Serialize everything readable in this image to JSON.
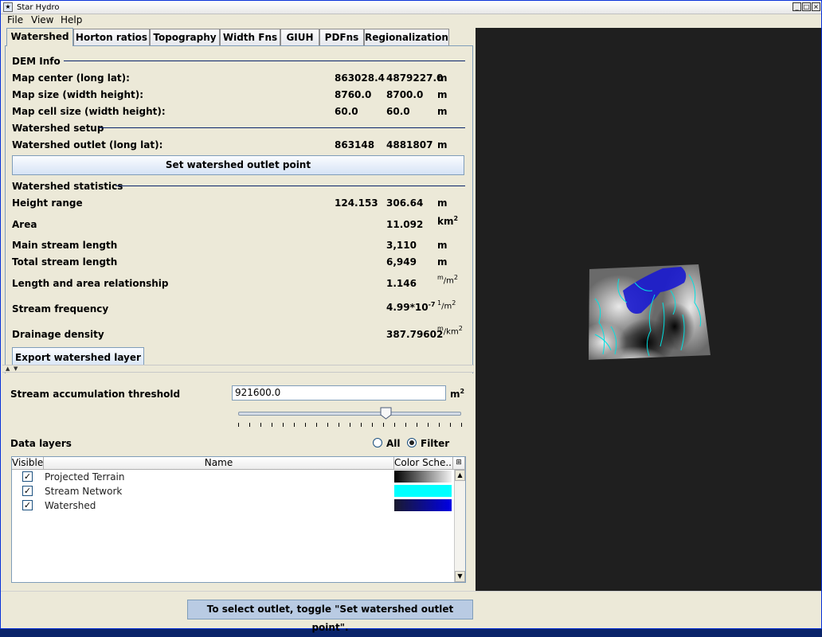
{
  "window": {
    "title": "Star Hydro"
  },
  "menu": [
    "File",
    "View",
    "Help"
  ],
  "tabs": [
    "Watershed",
    "Horton ratios",
    "Topography",
    "Width Fns",
    "GIUH",
    "PDFns",
    "Regionalization"
  ],
  "dem_info": {
    "heading": "DEM Info",
    "rows": [
      {
        "label": "Map center (long lat):",
        "v1": "863028.4",
        "v2": "4879227.0",
        "unit": "m"
      },
      {
        "label": "Map size (width height):",
        "v1": "8760.0",
        "v2": "8700.0",
        "unit": "m"
      },
      {
        "label": "Map cell size (width height):",
        "v1": "60.0",
        "v2": "60.0",
        "unit": "m"
      }
    ]
  },
  "setup": {
    "heading": "Watershed setup",
    "outlet": {
      "label": "Watershed outlet (long lat):",
      "v1": "863148",
      "v2": "4881807",
      "unit": "m"
    },
    "button": "Set watershed outlet point"
  },
  "stats": {
    "heading": "Watershed statistics",
    "height_range": {
      "label": "Height range",
      "v1": "124.153",
      "v2": "306.64",
      "unit": "m"
    },
    "area": {
      "label": "Area",
      "value": "11.092",
      "unit": "km",
      "unit_sup": "2"
    },
    "main_stream": {
      "label": "Main stream length",
      "value": "3,110",
      "unit": "m"
    },
    "total_stream": {
      "label": "Total stream length",
      "value": "6,949",
      "unit": "m"
    },
    "length_area": {
      "label": "Length and area relationship",
      "value": "1.146",
      "unit_num": "m",
      "unit_den": "m",
      "unit_sup": "2"
    },
    "stream_freq": {
      "label": "Stream frequency",
      "value": "4.99*10",
      "value_sup": "-7",
      "unit_num": "1",
      "unit_den": "m",
      "unit_sup": "2"
    },
    "drainage": {
      "label": "Drainage density",
      "value": "387.79602",
      "unit_num": "m",
      "unit_den": "km",
      "unit_sup": "2"
    },
    "export_button": "Export watershed layer"
  },
  "threshold": {
    "label": "Stream accumulation threshold",
    "value": "921600.0",
    "unit": "m",
    "unit_sup": "2",
    "slider_fraction": 0.66
  },
  "data_layers": {
    "label": "Data layers",
    "radio_all": "All",
    "radio_filter": "Filter",
    "selected": "Filter",
    "columns": [
      "Visible",
      "Name",
      "Color Sche..."
    ],
    "rows": [
      {
        "name": "Projected Terrain",
        "visible": true,
        "colors": [
          "#000000",
          "#f2f2f2"
        ]
      },
      {
        "name": "Stream Network",
        "visible": true,
        "colors": [
          "#00ffff",
          "#00ffff"
        ]
      },
      {
        "name": "Watershed",
        "visible": true,
        "colors": [
          "#1a1a2e",
          "#0000e6"
        ]
      }
    ]
  },
  "status": "To select outlet, toggle \"Set watershed outlet point\"."
}
